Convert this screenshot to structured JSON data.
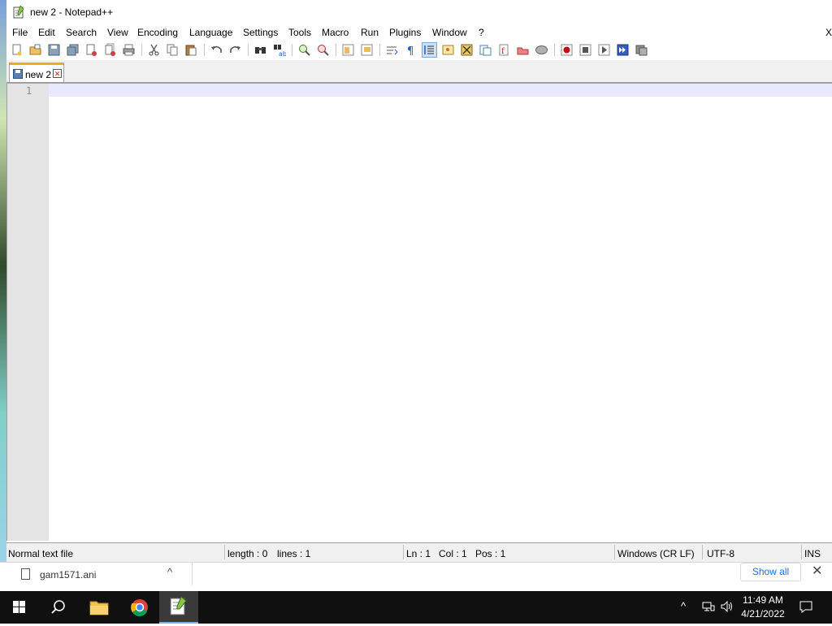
{
  "window": {
    "title": "new 2 - Notepad++"
  },
  "menu": {
    "items": [
      "File",
      "Edit",
      "Search",
      "View",
      "Encoding",
      "Language",
      "Settings",
      "Tools",
      "Macro",
      "Run",
      "Plugins",
      "Window",
      "?"
    ],
    "close_glyph": "X"
  },
  "toolbar": {
    "icons": [
      "new-file-icon",
      "open-file-icon",
      "save-icon",
      "save-all-icon",
      "close-icon",
      "close-all-icon",
      "print-icon",
      "cut-icon",
      "copy-icon",
      "paste-icon",
      "undo-icon",
      "redo-icon",
      "find-icon",
      "replace-icon",
      "zoom-in-icon",
      "zoom-out-icon",
      "sync-vertical-icon",
      "sync-horizontal-icon",
      "word-wrap-icon",
      "show-all-chars-icon",
      "indent-guide-icon",
      "user-language-icon",
      "doc-map-icon",
      "function-list-icon",
      "folder-workspace-icon",
      "monitoring-icon",
      "record-macro-icon",
      "stop-record-icon",
      "play-macro-icon",
      "run-macro-multiple-icon",
      "save-macro-icon"
    ]
  },
  "tab": {
    "label": "new 2",
    "close_glyph": "✕"
  },
  "editor": {
    "line_numbers": [
      "1"
    ],
    "content": ""
  },
  "status": {
    "file_type": "Normal text file",
    "length": "length : 0",
    "lines": "lines : 1",
    "ln": "Ln : 1",
    "col": "Col : 1",
    "pos": "Pos : 1",
    "eol": "Windows (CR LF)",
    "encoding": "UTF-8",
    "mode": "INS"
  },
  "downloads": {
    "filename": "gam1571.ani",
    "chevron": "^",
    "show_all": "Show all",
    "close_glyph": "✕"
  },
  "taskbar": {
    "clock_time": "11:49 AM",
    "clock_date": "4/21/2022",
    "tray_chevron": "^"
  },
  "colors": {
    "current_line": "#e8e8ff",
    "gutter": "#e4e4e4",
    "tab_accent": "#f5a623",
    "taskbar": "#101010",
    "link": "#1a73e8"
  }
}
